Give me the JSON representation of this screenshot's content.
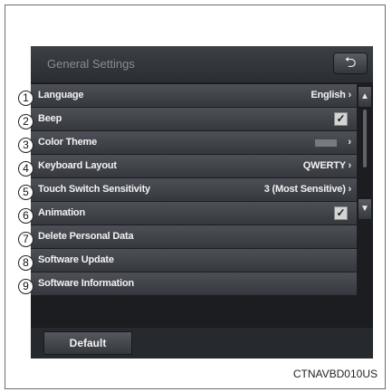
{
  "header": {
    "title": "General Settings",
    "back_icon": "back-arrow-icon"
  },
  "settings": [
    {
      "num": "1",
      "label": "Language",
      "value": "English",
      "chevron": "›",
      "type": "value"
    },
    {
      "num": "2",
      "label": "Beep",
      "type": "checkbox",
      "checked": true
    },
    {
      "num": "3",
      "label": "Color Theme",
      "chevron": "›",
      "type": "swatch"
    },
    {
      "num": "4",
      "label": "Keyboard Layout",
      "value": "QWERTY",
      "chevron": "›",
      "type": "value"
    },
    {
      "num": "5",
      "label": "Touch Switch Sensitivity",
      "value": "3 (Most Sensitive)",
      "chevron": "›",
      "type": "value"
    },
    {
      "num": "6",
      "label": "Animation",
      "type": "checkbox",
      "checked": true
    },
    {
      "num": "7",
      "label": "Delete Personal Data",
      "type": "action"
    },
    {
      "num": "8",
      "label": "Software Update",
      "type": "action"
    },
    {
      "num": "9",
      "label": "Software Information",
      "type": "action"
    }
  ],
  "footer": {
    "default_label": "Default"
  },
  "caption": "CTNAVBD010US",
  "icons": {
    "scroll_up": "up-arrow-icon",
    "scroll_down": "down-arrow-icon",
    "check": "checkmark-icon"
  },
  "colors": {
    "screen_bg": "#1b1d20",
    "row_bg": "#45494e",
    "text": "#f2f2f2"
  }
}
